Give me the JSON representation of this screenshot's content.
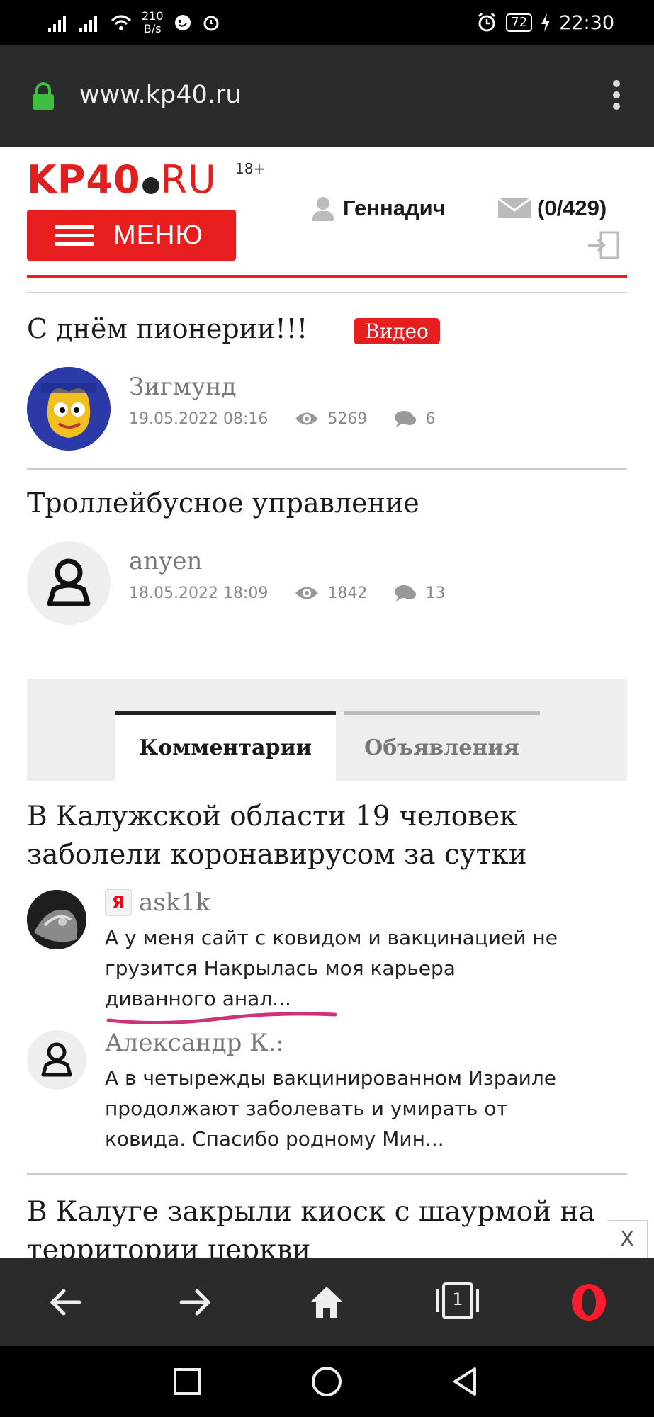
{
  "status_bar": {
    "net_speed_value": "210",
    "net_speed_unit": "B/s",
    "battery": "72",
    "time": "22:30"
  },
  "browser": {
    "url": "www.kp40.ru"
  },
  "header": {
    "logo_main": "KP40",
    "logo_ru": "RU",
    "age_rating": "18+",
    "menu_label": "МЕНЮ",
    "username": "Геннадич",
    "messages": "(0/429)"
  },
  "articles": [
    {
      "title": "С днём пионерии!!!",
      "badge": "Видео",
      "author": "Зигмунд",
      "date": "19.05.2022 08:16",
      "views": "5269",
      "comments": "6"
    },
    {
      "title": "Троллейбусное управление",
      "author": "anyen",
      "date": "18.05.2022 18:09",
      "views": "1842",
      "comments": "13"
    }
  ],
  "tabs": [
    {
      "label": "Комментарии",
      "active": true
    },
    {
      "label": "Объявления",
      "active": false
    }
  ],
  "comment_block": {
    "title_line1": "В Калужской области 19 человек",
    "title_line2": "заболели коронавирусом за сутки",
    "comments": [
      {
        "author": "ask1k",
        "line1": "А у меня сайт с ковидом и вакцинацией не",
        "line2": "грузится   Накрылась моя карьера",
        "line3": "диванного анал..."
      },
      {
        "author": "Александр К.:",
        "line1": "А в четырежды вакцинированном Израиле",
        "line2": "продолжают заболевать и умирать от",
        "line3": "ковида. Спасибо родному Мин..."
      }
    ]
  },
  "next_article": {
    "line1": "В Калуге закрыли киоск с шаурмой на",
    "line2": "территории церкви"
  },
  "close_label": "X",
  "bottom_bar": {
    "tab_count": "1"
  },
  "colors": {
    "brand_red": "#e81e1e",
    "underline_pink": "#d0307a"
  }
}
